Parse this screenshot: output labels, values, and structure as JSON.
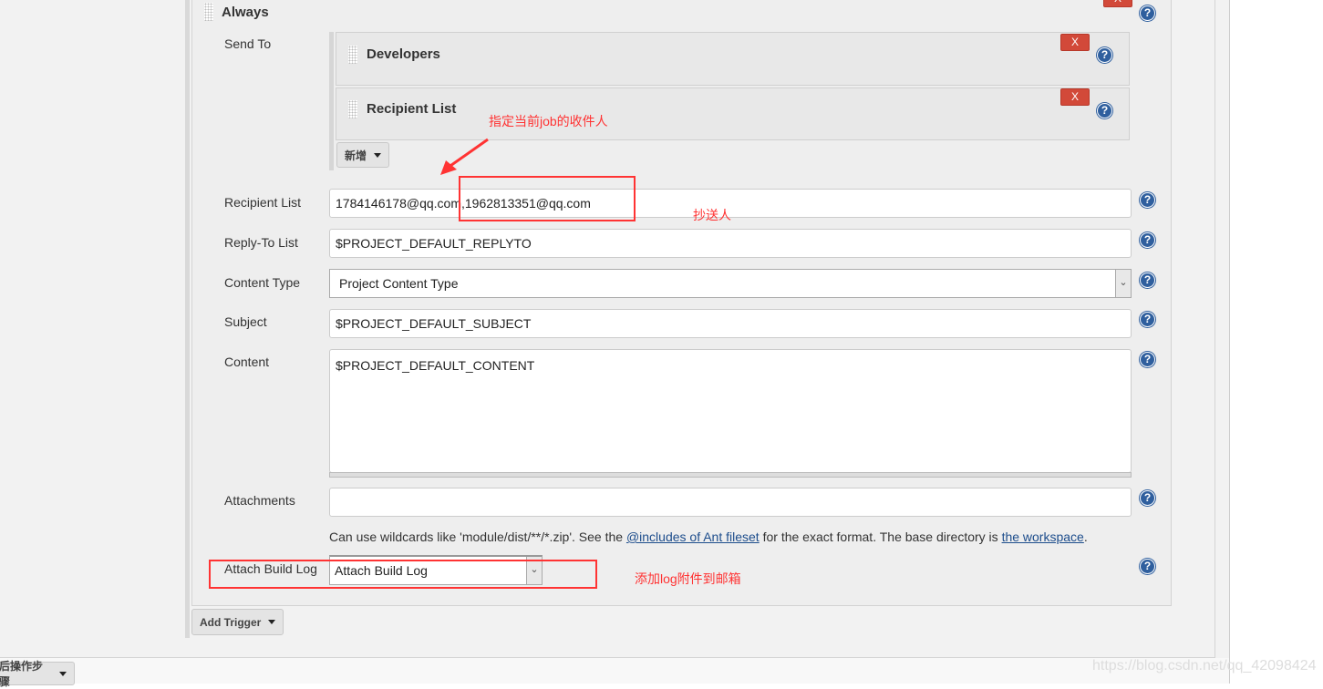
{
  "trigger": {
    "title": "Always",
    "delete_label": "X"
  },
  "send_to": {
    "label": "Send To",
    "items": [
      {
        "title": "Developers",
        "delete_label": "X"
      },
      {
        "title": "Recipient List",
        "delete_label": "X"
      }
    ],
    "add_button": "新增"
  },
  "fields": {
    "recipient_list": {
      "label": "Recipient List",
      "value": "1784146178@qq.com,1962813351@qq.com"
    },
    "reply_to": {
      "label": "Reply-To List",
      "value": "$PROJECT_DEFAULT_REPLYTO"
    },
    "content_type": {
      "label": "Content Type",
      "value": "Project Content Type"
    },
    "subject": {
      "label": "Subject",
      "value": "$PROJECT_DEFAULT_SUBJECT"
    },
    "content": {
      "label": "Content",
      "value": "$PROJECT_DEFAULT_CONTENT"
    },
    "attachments": {
      "label": "Attachments",
      "value": ""
    },
    "attachments_help": {
      "prefix": "Can use wildcards like 'module/dist/**/*.zip'. See the ",
      "link1": "@includes of Ant fileset",
      "middle": " for the exact format. The base directory is ",
      "link2": "the workspace",
      "suffix": "."
    },
    "attach_build_log": {
      "label": "Attach Build Log",
      "value": "Attach Build Log"
    }
  },
  "add_trigger": "Add Trigger",
  "bottom_button": "后操作步骤",
  "annotations": {
    "recipients": "指定当前job的收件人",
    "cc": "抄送人",
    "attach_log": "添加log附件到邮箱"
  },
  "watermark": "https://blog.csdn.net/qq_42098424",
  "colors": {
    "delete": "#d24939",
    "help": "#2f5f9e",
    "annotation": "#ff3333",
    "link": "#1d4d8c"
  }
}
